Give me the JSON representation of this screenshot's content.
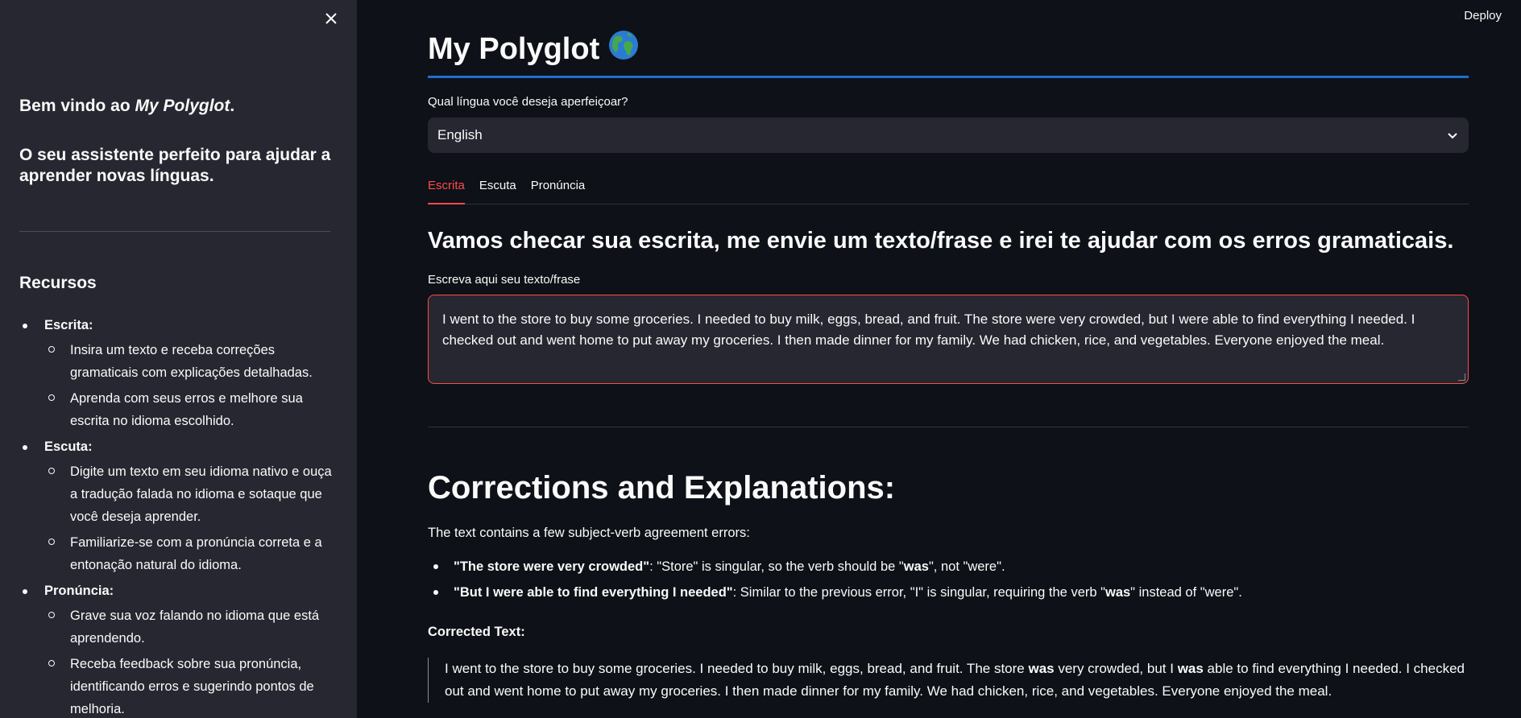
{
  "sidebar": {
    "close_icon": "close-icon",
    "welcome_prefix": "Bem vindo ao ",
    "welcome_app": "My Polyglot",
    "welcome_suffix": ".",
    "tagline": "O seu assistente perfeito para ajudar a aprender novas línguas.",
    "recursos_heading": "Recursos",
    "items": [
      {
        "label": "Escrita:",
        "subitems": [
          "Insira um texto e receba correções gramaticais com explicações detalhadas.",
          "Aprenda com seus erros e melhore sua escrita no idioma escolhido."
        ]
      },
      {
        "label": "Escuta:",
        "subitems": [
          "Digite um texto em seu idioma nativo e ouça a tradução falada no idioma e sotaque que você deseja aprender.",
          "Familiarize-se com a pronúncia correta e a entonação natural do idioma."
        ]
      },
      {
        "label": "Pronúncia:",
        "subitems": [
          "Grave sua voz falando no idioma que está aprendendo.",
          "Receba feedback sobre sua pronúncia, identificando erros e sugerindo pontos de melhoria."
        ]
      }
    ]
  },
  "header": {
    "deploy_label": "Deploy"
  },
  "main": {
    "title": "My Polyglot",
    "title_icon": "globe-icon",
    "language_label": "Qual língua você deseja aperfeiçoar?",
    "language_selected": "English",
    "tabs": [
      {
        "label": "Escrita",
        "active": true
      },
      {
        "label": "Escuta",
        "active": false
      },
      {
        "label": "Pronúncia",
        "active": false
      }
    ],
    "section_heading": "Vamos checar sua escrita, me envie um texto/frase e irei te ajudar com os erros gramaticais.",
    "text_label": "Escreva aqui seu texto/frase",
    "text_value": "I went to the store to buy some groceries. I needed to buy milk, eggs, bread, and fruit. The store were very crowded, but I were able to find everything I needed. I checked out and went home to put away my groceries. I then made dinner for my family. We had chicken, rice, and vegetables. Everyone enjoyed the meal.",
    "corrections_heading": "Corrections and Explanations:",
    "corrections_intro": "The text contains a few subject-verb agreement errors:",
    "corrections": [
      {
        "phrase": "\"The store were very crowded\"",
        "pre": ": \"Store\" is singular, so the verb should be \"",
        "fix": "was",
        "post": "\", not \"were\"."
      },
      {
        "phrase": "\"But I were able to find everything I needed\"",
        "pre": ": Similar to the previous error, \"I\" is singular, requiring the verb \"",
        "fix": "was",
        "post": "\" instead of \"were\"."
      }
    ],
    "corrected_label": "Corrected Text:",
    "corrected_parts": {
      "p1": "I went to the store to buy some groceries. I needed to buy milk, eggs, bread, and fruit. The store ",
      "b1": "was",
      "p2": " very crowded, but I ",
      "b2": "was",
      "p3": " able to find everything I needed. I checked out and went home to put away my groceries. I then made dinner for my family. We had chicken, rice, and vegetables. Everyone enjoyed the meal."
    }
  },
  "colors": {
    "background": "#0e1117",
    "sidebar": "#262730",
    "accent_red": "#ff4b4b",
    "title_underline": "#1c6fd1"
  }
}
